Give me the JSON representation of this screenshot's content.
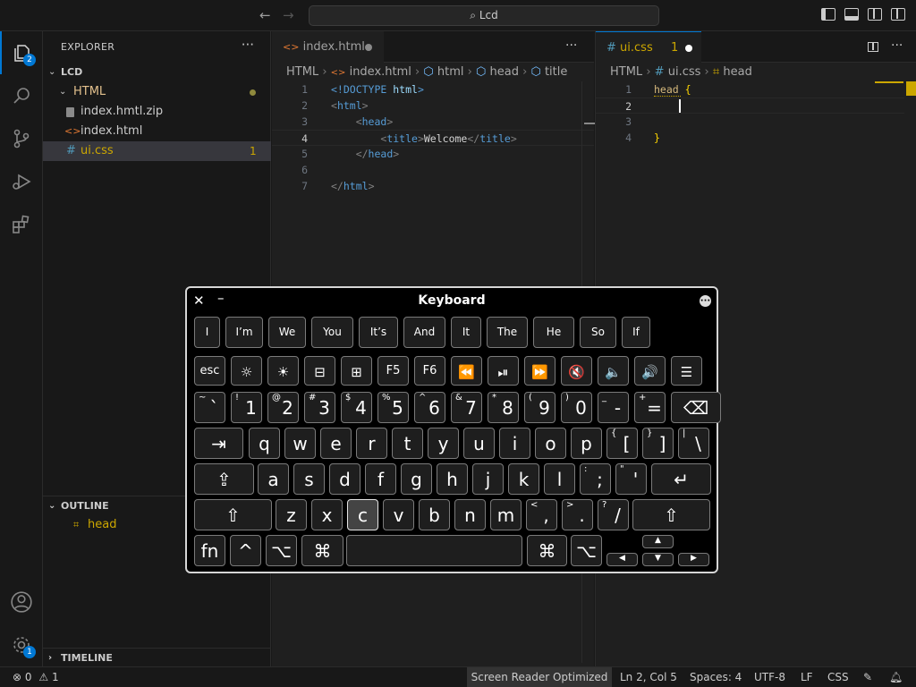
{
  "titlebar": {
    "search": "Lcd",
    "back_icon": "arrow-left-icon",
    "forward_icon": "arrow-right-icon"
  },
  "activity": {
    "explorer_badge": "2",
    "settings_badge": "1"
  },
  "sidebar": {
    "header": "EXPLORER",
    "more": "···",
    "root": "LCD",
    "items": [
      {
        "label": "HTML",
        "kind": "folder"
      },
      {
        "label": "index.hmtl.zip",
        "kind": "zip"
      },
      {
        "label": "index.html",
        "kind": "html"
      },
      {
        "label": "ui.css",
        "kind": "css",
        "badge": "1"
      }
    ],
    "outline_header": "OUTLINE",
    "outline_item": "head",
    "timeline_header": "TIMELINE"
  },
  "editor1": {
    "tab_label": "index.html",
    "breadcrumb": [
      "HTML",
      "index.html",
      "html",
      "head",
      "title"
    ],
    "lines": [
      {
        "n": "1",
        "tokens": [
          {
            "t": "<!DOCTYPE ",
            "c": "#569cd6"
          },
          {
            "t": "html",
            "c": "#9cdcfe"
          },
          {
            "t": ">",
            "c": "#569cd6"
          }
        ]
      },
      {
        "n": "2",
        "tokens": [
          {
            "t": "<",
            "c": "#808080"
          },
          {
            "t": "html",
            "c": "#569cd6"
          },
          {
            "t": ">",
            "c": "#808080"
          }
        ]
      },
      {
        "n": "3",
        "tokens": [
          {
            "t": "    <",
            "c": "#808080"
          },
          {
            "t": "head",
            "c": "#569cd6"
          },
          {
            "t": ">",
            "c": "#808080"
          }
        ]
      },
      {
        "n": "4",
        "tokens": [
          {
            "t": "        <",
            "c": "#808080"
          },
          {
            "t": "title",
            "c": "#569cd6"
          },
          {
            "t": ">",
            "c": "#808080"
          },
          {
            "t": "Welcome",
            "c": "#d4d4d4"
          },
          {
            "t": "</",
            "c": "#808080"
          },
          {
            "t": "title",
            "c": "#569cd6"
          },
          {
            "t": ">",
            "c": "#808080"
          }
        ]
      },
      {
        "n": "5",
        "tokens": [
          {
            "t": "    </",
            "c": "#808080"
          },
          {
            "t": "head",
            "c": "#569cd6"
          },
          {
            "t": ">",
            "c": "#808080"
          }
        ]
      },
      {
        "n": "6",
        "tokens": []
      },
      {
        "n": "7",
        "tokens": [
          {
            "t": "</",
            "c": "#808080"
          },
          {
            "t": "html",
            "c": "#569cd6"
          },
          {
            "t": ">",
            "c": "#808080"
          }
        ]
      }
    ],
    "current_line": "4"
  },
  "editor2": {
    "tab_label": "ui.css",
    "tab_badge": "1",
    "breadcrumb": [
      "HTML",
      "ui.css",
      "head"
    ],
    "lines": [
      {
        "n": "1",
        "tokens": [
          {
            "t": "head ",
            "c": "#d7ba7d"
          },
          {
            "t": "{",
            "c": "#ffd700"
          }
        ]
      },
      {
        "n": "2",
        "tokens": []
      },
      {
        "n": "3",
        "tokens": []
      },
      {
        "n": "4",
        "tokens": [
          {
            "t": "}",
            "c": "#ffd700"
          }
        ]
      }
    ],
    "current_line": "2"
  },
  "keyboard": {
    "title": "Keyboard",
    "suggestions": [
      "I",
      "I’m",
      "We",
      "You",
      "It’s",
      "And",
      "It",
      "The",
      "He",
      "So",
      "If"
    ],
    "fn_row": [
      "esc",
      "☼",
      "☀",
      "⊟",
      "⊞",
      "F5",
      "F6",
      "⏪",
      "⏯",
      "⏩",
      "🔇",
      "🔈",
      "🔊",
      "☰"
    ],
    "row1": [
      {
        "sub": "~",
        "main": "`"
      },
      {
        "sub": "!",
        "main": "1"
      },
      {
        "sub": "@",
        "main": "2"
      },
      {
        "sub": "#",
        "main": "3"
      },
      {
        "sub": "$",
        "main": "4"
      },
      {
        "sub": "%",
        "main": "5"
      },
      {
        "sub": "^",
        "main": "6"
      },
      {
        "sub": "&",
        "main": "7"
      },
      {
        "sub": "*",
        "main": "8"
      },
      {
        "sub": "(",
        "main": "9"
      },
      {
        "sub": ")",
        "main": "0"
      },
      {
        "sub": "_",
        "main": "-"
      },
      {
        "sub": "+",
        "main": "="
      }
    ],
    "backspace": "⌫",
    "tab": "⇥",
    "row2": [
      "q",
      "w",
      "e",
      "r",
      "t",
      "y",
      "u",
      "i",
      "o",
      "p"
    ],
    "row2_sym": [
      {
        "sub": "{",
        "main": "["
      },
      {
        "sub": "}",
        "main": "]"
      },
      {
        "sub": "|",
        "main": "\\"
      }
    ],
    "capslock": "⇪",
    "row3": [
      "a",
      "s",
      "d",
      "f",
      "g",
      "h",
      "j",
      "k",
      "l"
    ],
    "row3_sym": [
      {
        "sub": ":",
        "main": ";"
      },
      {
        "sub": "\"",
        "main": "'"
      }
    ],
    "enter": "↵",
    "shift": "⇧",
    "row4": [
      "z",
      "x",
      "c",
      "v",
      "b",
      "n",
      "m"
    ],
    "row4_sym": [
      {
        "sub": "<",
        "main": ","
      },
      {
        "sub": ">",
        "main": "."
      },
      {
        "sub": "?",
        "main": "/"
      }
    ],
    "bottom": {
      "fn": "fn",
      "ctrl": "^",
      "alt": "⌥",
      "cmd": "⌘"
    },
    "arrows": {
      "up": "▲",
      "down": "▼",
      "left": "◀",
      "right": "▶"
    },
    "pressed_key": "c"
  },
  "status": {
    "errors": "0",
    "warnings": "1",
    "screen_reader": "Screen Reader Optimized",
    "position": "Ln 2, Col 5",
    "spaces": "Spaces: 4",
    "encoding": "UTF-8",
    "eol": "LF",
    "language": "CSS"
  }
}
